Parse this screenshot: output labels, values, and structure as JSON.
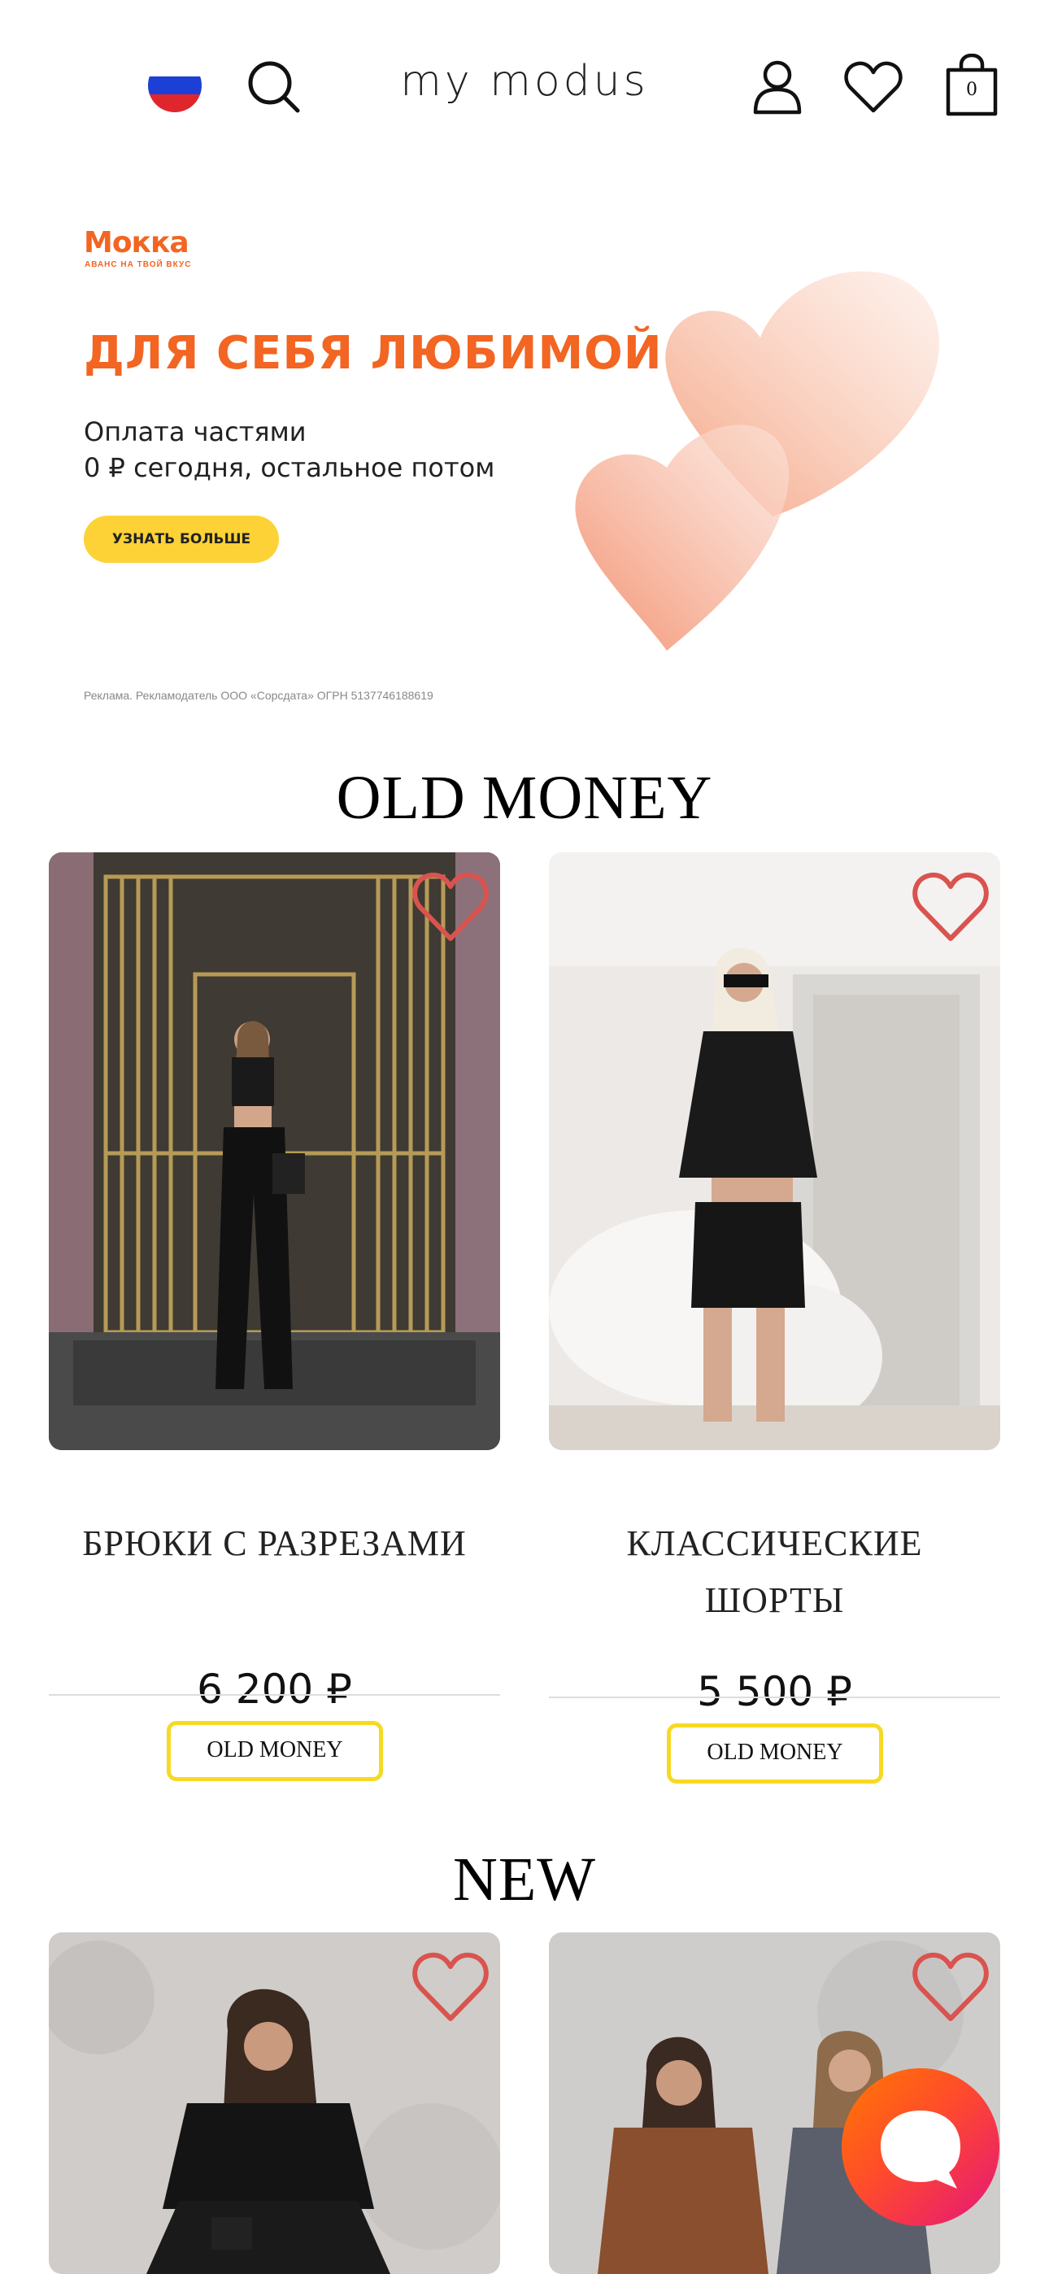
{
  "header": {
    "logo": "MY MODUS",
    "cart_count": "0",
    "icons": [
      "russian-flag-icon",
      "search-icon",
      "user-icon",
      "heart-icon",
      "shopping-bag-icon"
    ]
  },
  "banner": {
    "brand": "Мокка",
    "tagline": "АВАНС НА ТВОЙ ВКУС",
    "title": "ДЛЯ СЕБЯ ЛЮБИМОЙ",
    "line1": "Оплата частями",
    "line2": "0 ₽ сегодня, остальное потом",
    "button": "УЗНАТЬ БОЛЬШЕ",
    "legal": "Реклама. Рекламодатель ООО «Сорсдата» ОГРН 5137746188619",
    "accent": "#f26522",
    "button_color": "#fcd236"
  },
  "sections": [
    {
      "title": "OLD MONEY",
      "products": [
        {
          "name": "БРЮКИ С РАЗРЕЗАМИ",
          "price": "6 200 ₽",
          "tag": "OLD MONEY"
        },
        {
          "name_line1": "КЛАССИЧЕСКИЕ",
          "name_line2": "ШОРТЫ",
          "price": "5 500 ₽",
          "tag": "OLD MONEY"
        }
      ]
    },
    {
      "title": "NEW"
    }
  ],
  "colors": {
    "tag_border": "#f7d923",
    "favorite": "#d9534f"
  }
}
